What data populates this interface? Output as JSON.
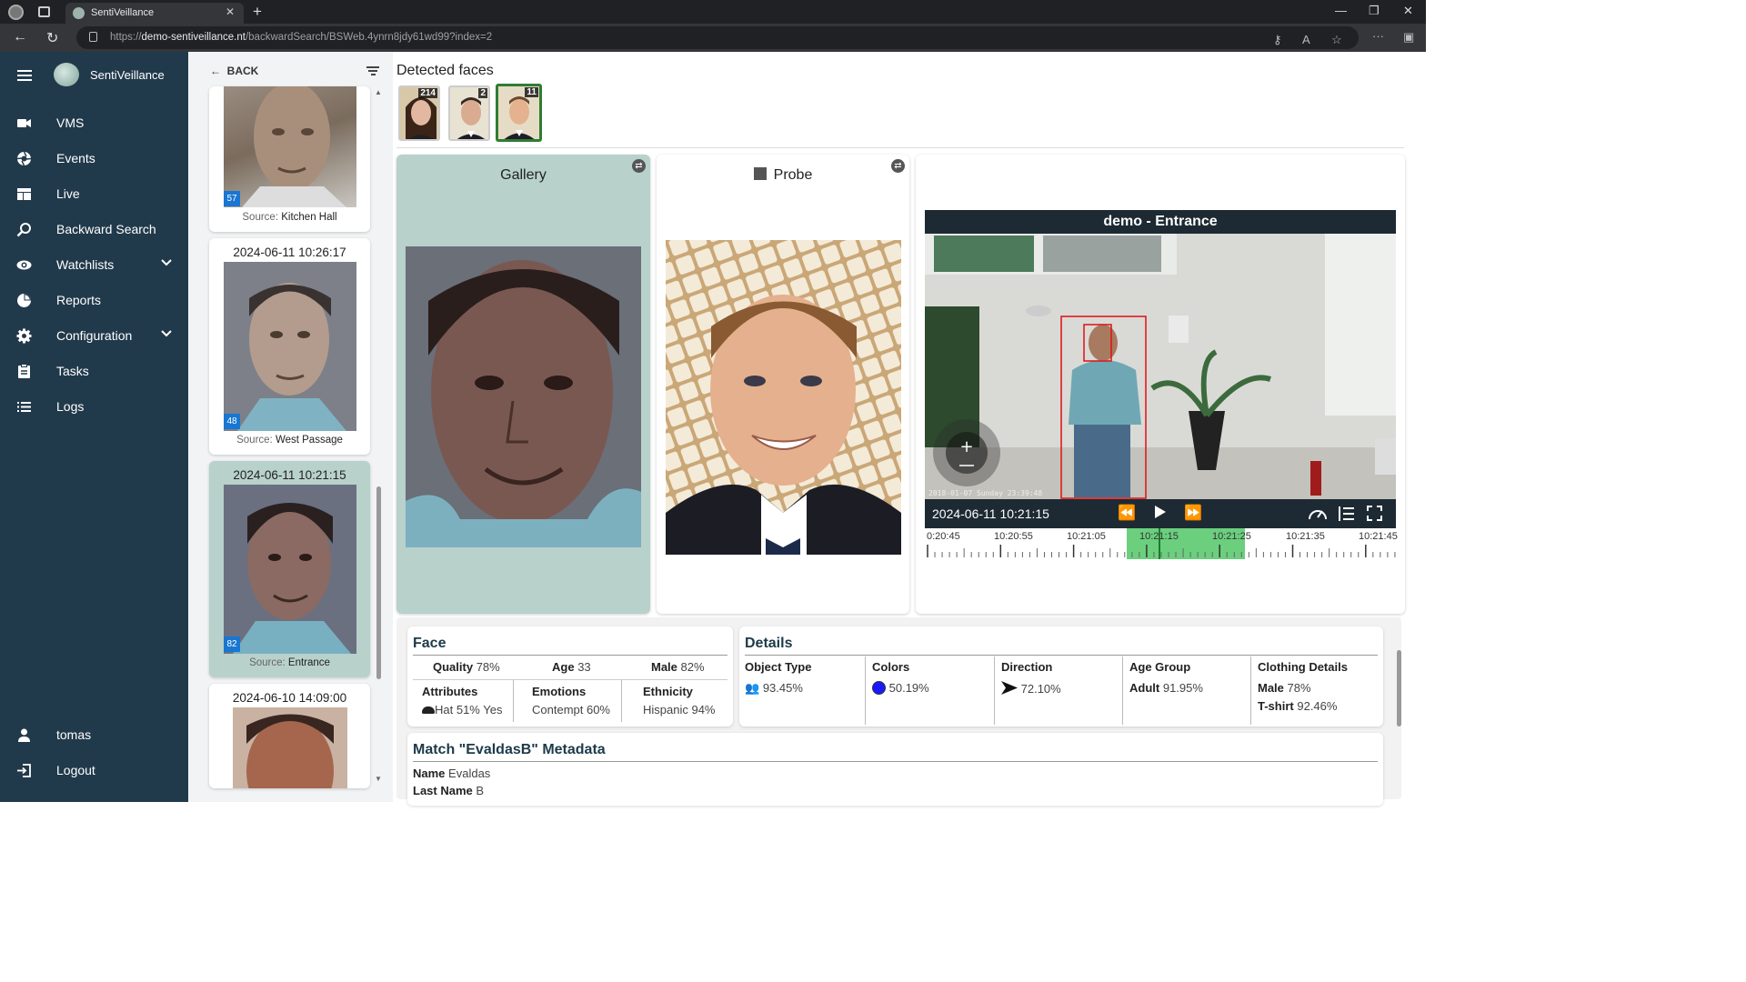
{
  "browser": {
    "tab_title": "SentiVeillance",
    "url_prefix": "https://",
    "url_host": "demo-sentiveillance.nt",
    "url_path": "/backwardSearch/BSWeb.4ynrn8jdy61wd99?index=2"
  },
  "sidebar": {
    "brand": "SentiVeillance",
    "items": [
      {
        "label": "VMS",
        "icon": "camera-icon"
      },
      {
        "label": "Events",
        "icon": "aperture-icon"
      },
      {
        "label": "Live",
        "icon": "dashboard-icon"
      },
      {
        "label": "Backward Search",
        "icon": "search-icon"
      },
      {
        "label": "Watchlists",
        "icon": "eye-icon"
      },
      {
        "label": "Reports",
        "icon": "pie-chart-icon"
      },
      {
        "label": "Configuration",
        "icon": "gear-icon"
      },
      {
        "label": "Tasks",
        "icon": "clipboard-icon"
      },
      {
        "label": "Logs",
        "icon": "list-icon"
      }
    ],
    "user": "tomas",
    "logout": "Logout"
  },
  "results": {
    "back_label": "BACK",
    "cards": [
      {
        "date": "",
        "badge": "57",
        "source_label": "Source:",
        "source": "Kitchen Hall"
      },
      {
        "date": "2024-06-11 10:26:17",
        "badge": "48",
        "source_label": "Source:",
        "source": "West Passage"
      },
      {
        "date": "2024-06-11 10:21:15",
        "badge": "82",
        "source_label": "Source:",
        "source": "Entrance"
      },
      {
        "date": "2024-06-10 14:09:00",
        "badge": "",
        "source_label": "",
        "source": ""
      }
    ]
  },
  "detected": {
    "title": "Detected faces",
    "faces": [
      {
        "count": "214"
      },
      {
        "count": "2"
      },
      {
        "count": "11"
      }
    ]
  },
  "gallery": {
    "title": "Gallery"
  },
  "probe": {
    "title": "Probe"
  },
  "video": {
    "title": "demo - Entrance",
    "timestamp": "2024-06-11 10:21:15",
    "overlay_time": "2018-01-07 Sunday 23:39:48",
    "ticks": [
      "0:20:45",
      "10:20:55",
      "10:21:05",
      "10:21:15",
      "10:21:25",
      "10:21:35",
      "10:21:45"
    ]
  },
  "face": {
    "title": "Face",
    "quality_label": "Quality",
    "quality": "78%",
    "age_label": "Age",
    "age": "33",
    "gender_label": "Male",
    "gender": "82%",
    "attributes_label": "Attributes",
    "attributes": "Hat 51% Yes",
    "emotions_label": "Emotions",
    "emotions": "Contempt 60%",
    "ethnicity_label": "Ethnicity",
    "ethnicity": "Hispanic 94%"
  },
  "details": {
    "title": "Details",
    "object_type_label": "Object Type",
    "object_type": "93.45%",
    "colors_label": "Colors",
    "colors": "50.19%",
    "color_swatch": "#1a1aff",
    "direction_label": "Direction",
    "direction": "72.10%",
    "age_group_label": "Age Group",
    "age_group_name": "Adult",
    "age_group": "91.95%",
    "clothing_label": "Clothing Details",
    "clothing_1_name": "Male",
    "clothing_1": "78%",
    "clothing_2_name": "T-shirt",
    "clothing_2": "92.46%"
  },
  "metadata": {
    "title": "Match \"EvaldasB\" Metadata",
    "name_label": "Name",
    "name": "Evaldas",
    "last_name_label": "Last Name",
    "last_name": "B"
  }
}
